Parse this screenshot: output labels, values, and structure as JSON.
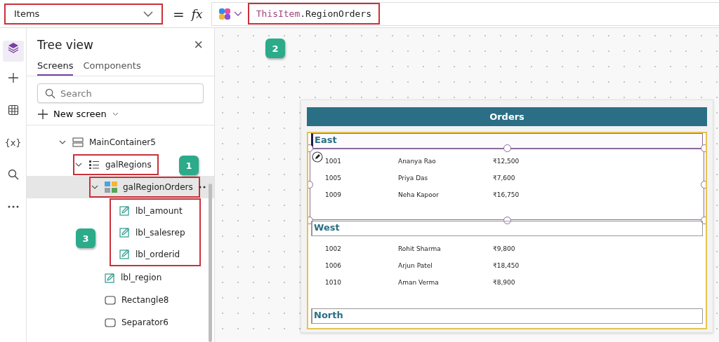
{
  "formula_bar": {
    "property": "Items",
    "equals": "=",
    "fx": "fx",
    "formula": [
      {
        "text": "ThisItem",
        "kind": "keyword"
      },
      {
        "text": ".RegionOrders",
        "kind": "plain"
      }
    ],
    "property_highlighted": true,
    "formula_highlighted": true
  },
  "rail": [
    {
      "kind": "layers",
      "selected": true
    },
    {
      "kind": "plus",
      "selected": false
    },
    {
      "kind": "table",
      "selected": false
    },
    {
      "kind": "variables",
      "label": "{x}",
      "selected": false
    },
    {
      "kind": "search",
      "selected": false
    },
    {
      "kind": "more",
      "selected": false
    }
  ],
  "tree_view": {
    "title": "Tree view",
    "close": "×",
    "tabs": [
      {
        "label": "Screens",
        "selected": true
      },
      {
        "label": "Components",
        "selected": false
      }
    ],
    "search": {
      "placeholder": "Search"
    },
    "new_screen": "New screen",
    "items": [
      {
        "name": "MainContainer5",
        "kind": "container",
        "expanded": true,
        "selected": false,
        "highlighted": false,
        "children": [
          {
            "name": "galRegions",
            "kind": "gallery-list",
            "expanded": true,
            "selected": false,
            "highlighted": true,
            "children": [
              {
                "name": "galRegionOrders",
                "kind": "gallery",
                "expanded": true,
                "selected": true,
                "highlighted": true,
                "children_boxed": true,
                "children": [
                  {
                    "name": "lbl_amount",
                    "kind": "label",
                    "selected": false,
                    "highlighted": false
                  },
                  {
                    "name": "lbl_salesrep",
                    "kind": "label",
                    "selected": false,
                    "highlighted": false
                  },
                  {
                    "name": "lbl_orderid",
                    "kind": "label",
                    "selected": false,
                    "highlighted": false
                  }
                ]
              },
              {
                "name": "lbl_region",
                "kind": "label",
                "selected": false,
                "highlighted": false
              },
              {
                "name": "Rectangle8",
                "kind": "rectangle",
                "selected": false,
                "highlighted": false
              },
              {
                "name": "Separator6",
                "kind": "rectangle",
                "selected": false,
                "highlighted": false
              }
            ]
          }
        ]
      }
    ]
  },
  "canvas": {
    "header": "Orders",
    "groups": [
      {
        "region": "East",
        "selected": true,
        "rows": [
          [
            "1001",
            "Ananya Rao",
            "₹12,500"
          ],
          [
            "1005",
            "Priya Das",
            "₹7,600"
          ],
          [
            "1009",
            "Neha Kapoor",
            "₹16,750"
          ]
        ]
      },
      {
        "region": "West",
        "selected": false,
        "rows": [
          [
            "1002",
            "Rohit Sharma",
            "₹9,800"
          ],
          [
            "1006",
            "Arjun Patel",
            "₹18,450"
          ],
          [
            "1010",
            "Aman Verma",
            "₹8,900"
          ]
        ]
      },
      {
        "region": "North",
        "selected": false
      }
    ]
  },
  "callouts": [
    {
      "label": "1"
    },
    {
      "label": "2"
    },
    {
      "label": "3"
    }
  ]
}
